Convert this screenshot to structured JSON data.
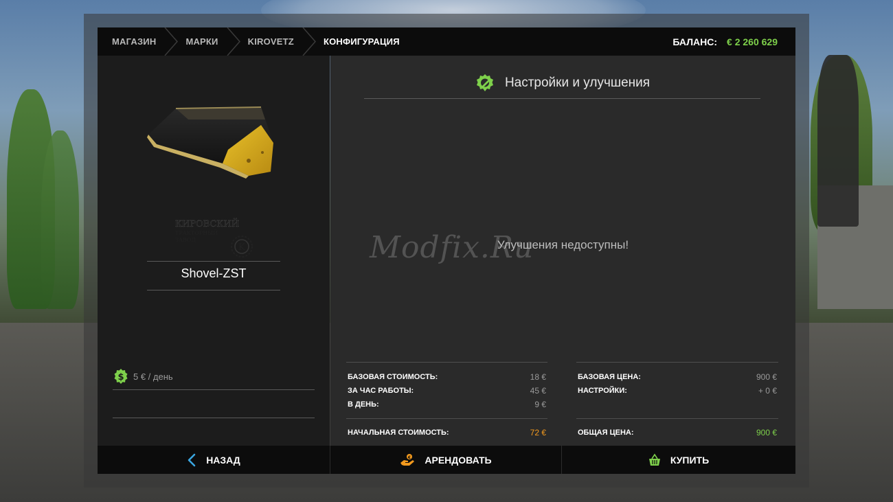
{
  "breadcrumb": {
    "items": [
      "МАГАЗИН",
      "МАРКИ",
      "KIROVETZ",
      "КОНФИГУРАЦИЯ"
    ]
  },
  "balance": {
    "label": "БАЛАНС:",
    "value": "€ 2 260 629"
  },
  "product": {
    "name": "Shovel-ZST",
    "maker_logo_text": "КИРОВСКИЙ ТРАКТОРНЫЙ ЗАВОД",
    "rent_price": "5 € / день"
  },
  "upgrades": {
    "title": "Настройки и улучшения",
    "empty_message": "Улучшения недоступны!"
  },
  "watermark": "Modfix.Ru",
  "costs": {
    "rows": [
      {
        "label": "БАЗОВАЯ СТОИМОСТЬ:",
        "value": "18 €"
      },
      {
        "label": "ЗА ЧАС РАБОТЫ:",
        "value": "45 €"
      },
      {
        "label": "В ДЕНЬ:",
        "value": "9 €"
      }
    ],
    "total": {
      "label": "НАЧАЛЬНАЯ СТОИМОСТЬ:",
      "value": "72 €"
    }
  },
  "prices": {
    "rows": [
      {
        "label": "БАЗОВАЯ ЦЕНА:",
        "value": "900 €"
      },
      {
        "label": "НАСТРОЙКИ:",
        "value": "+ 0 €"
      }
    ],
    "total": {
      "label": "ОБЩАЯ ЦЕНА:",
      "value": "900 €"
    }
  },
  "buttons": {
    "back": "НАЗАД",
    "rent": "АРЕНДОВАТЬ",
    "buy": "КУПИТЬ"
  },
  "icons": {
    "back": "chevron-left-icon",
    "rent": "hand-coin-icon",
    "buy": "basket-icon",
    "settings": "gear-wrench-icon",
    "money": "dollar-gear-icon"
  },
  "colors": {
    "accent_green": "#7ed04b",
    "accent_orange": "#f39a1e",
    "accent_blue": "#3aa6e0"
  }
}
